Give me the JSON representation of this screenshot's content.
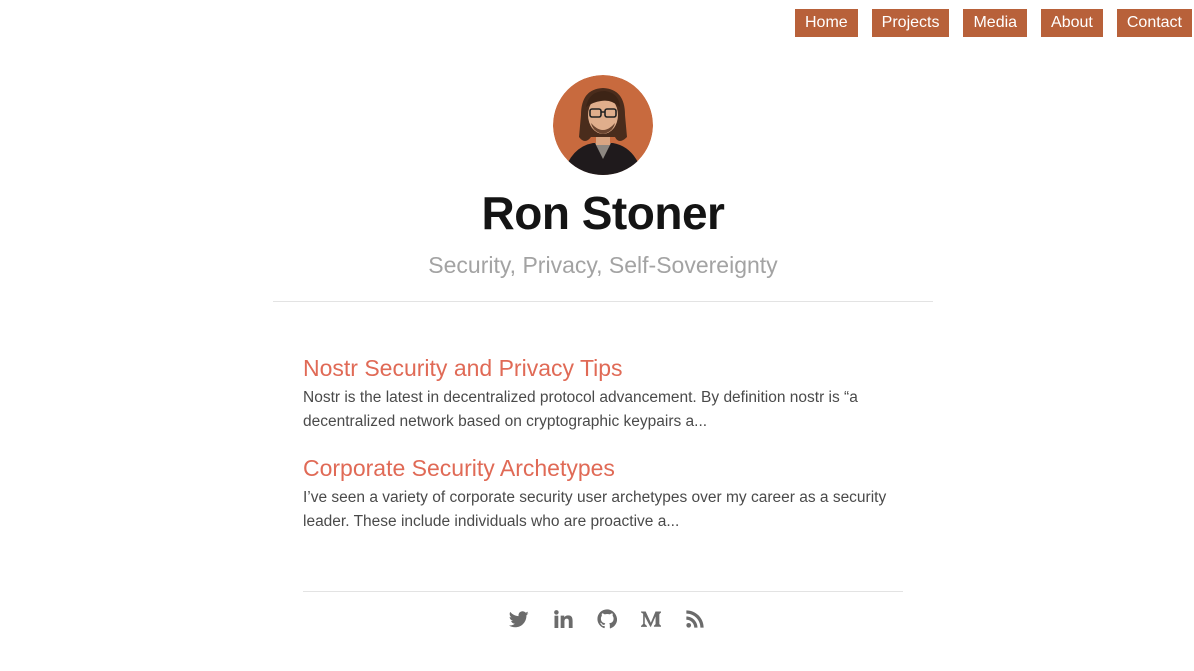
{
  "nav": {
    "items": [
      {
        "label": "Home"
      },
      {
        "label": "Projects"
      },
      {
        "label": "Media"
      },
      {
        "label": "About"
      },
      {
        "label": "Contact"
      }
    ]
  },
  "header": {
    "title": "Ron Stoner",
    "subtitle": "Security, Privacy, Self-Sovereignty",
    "avatar_icon": "avatar-portrait"
  },
  "posts": [
    {
      "title": "Nostr Security and Privacy Tips",
      "excerpt": "Nostr is the latest in decentralized protocol advancement. By definition nostr is “a decentralized network based on cryptographic keypairs a..."
    },
    {
      "title": "Corporate Security Archetypes",
      "excerpt": "I’ve seen a variety of corporate security user archetypes over my career as a security leader. These include individuals who are proactive a..."
    }
  ],
  "social": [
    {
      "name": "twitter-icon"
    },
    {
      "name": "linkedin-icon"
    },
    {
      "name": "github-icon"
    },
    {
      "name": "medium-icon"
    },
    {
      "name": "rss-icon"
    }
  ],
  "colors": {
    "accent": "#b8613a",
    "link": "#e06a56",
    "icon": "#6b6b6b"
  }
}
